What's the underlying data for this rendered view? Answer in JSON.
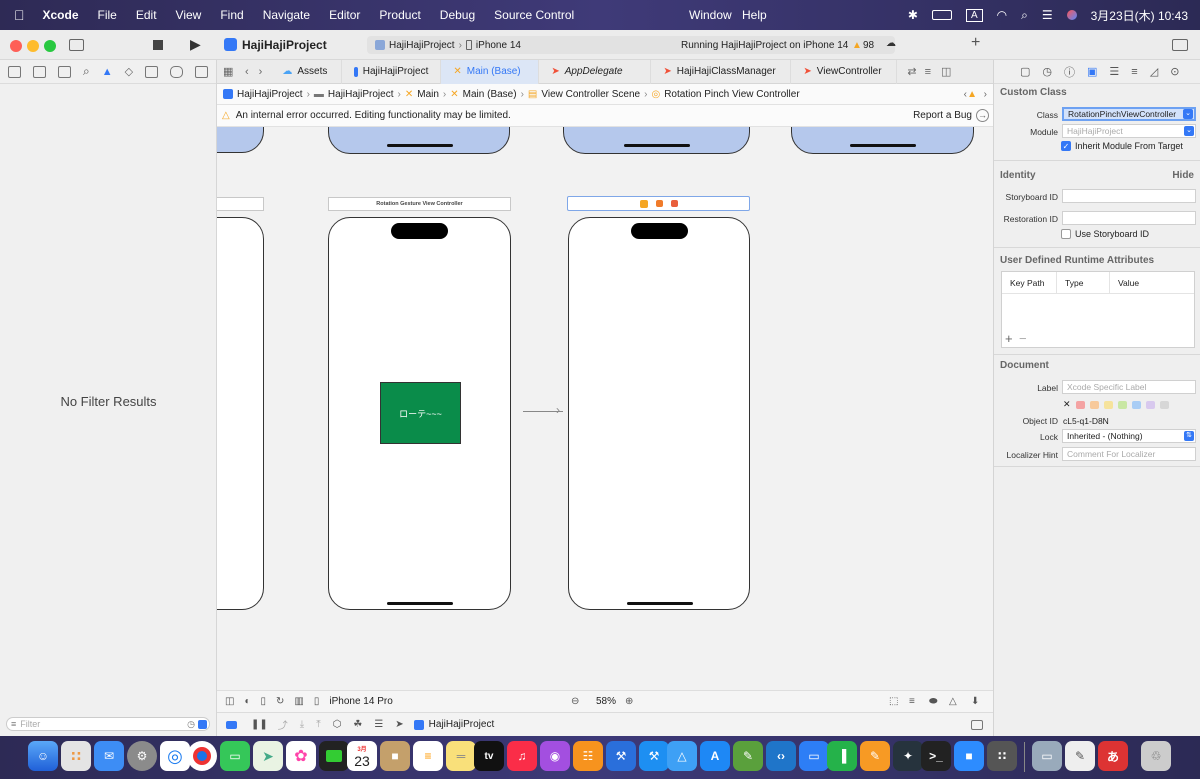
{
  "menubar": {
    "app": "Xcode",
    "items": [
      "File",
      "Edit",
      "View",
      "Find",
      "Navigate",
      "Editor",
      "Product",
      "Debug",
      "Source Control"
    ],
    "window_items": [
      "Window",
      "Help"
    ],
    "input_indicator": "A",
    "datetime": "3月23日(木) 10:43"
  },
  "toolbar": {
    "project_title": "HajiHajiProject",
    "scheme": "HajiHajiProject",
    "device": "iPhone 14",
    "status": "Running HajiHajiProject on iPhone 14",
    "warning_count": "98",
    "add_label": "+"
  },
  "navigator": {
    "no_results": "No Filter Results",
    "filter_placeholder": "Filter"
  },
  "tabs": [
    {
      "label": "Assets"
    },
    {
      "label": "HajiHajiProject"
    },
    {
      "label": "Main (Base)"
    },
    {
      "label": "AppDelegate"
    },
    {
      "label": "HajiHajiClassManager"
    },
    {
      "label": "ViewController"
    }
  ],
  "jumpbar": [
    "HajiHajiProject",
    "HajiHajiProject",
    "Main",
    "Main (Base)",
    "View Controller Scene",
    "Rotation Pinch View Controller"
  ],
  "warning": {
    "message": "An internal error occurred. Editing functionality may be limited.",
    "report": "Report a Bug"
  },
  "canvas": {
    "scene_title": "Rotation Gesture View Controller",
    "button_label": "ローテ~~~",
    "button_color": "#0a8c4a"
  },
  "editor_bottom": {
    "device": "iPhone 14 Pro",
    "zoom": "58%"
  },
  "debugbar": {
    "target": "HajiHajiProject"
  },
  "inspector": {
    "custom_class_title": "Custom Class",
    "class_label": "Class",
    "class_value": "RotationPinchViewController",
    "module_label": "Module",
    "module_placeholder": "HajiHajiProject",
    "inherit_label": "Inherit Module From Target",
    "identity_title": "Identity",
    "hide_label": "Hide",
    "storyboard_id_label": "Storyboard ID",
    "restoration_id_label": "Restoration ID",
    "use_storyboard_id_label": "Use Storyboard ID",
    "runtime_title": "User Defined Runtime Attributes",
    "col_key_path": "Key Path",
    "col_type": "Type",
    "col_value": "Value",
    "document_title": "Document",
    "label_label": "Label",
    "label_placeholder": "Xcode Specific Label",
    "object_id_label": "Object ID",
    "object_id_value": "cL5-q1-D8N",
    "lock_label": "Lock",
    "lock_value": "Inherited - (Nothing)",
    "localizer_label": "Localizer Hint",
    "localizer_placeholder": "Comment For Localizer"
  },
  "dock": {
    "calendar_month": "3月",
    "calendar_day": "23",
    "tv_label": "tv"
  },
  "colors": {
    "accent": "#3478f6",
    "warning": "#f5a623"
  }
}
